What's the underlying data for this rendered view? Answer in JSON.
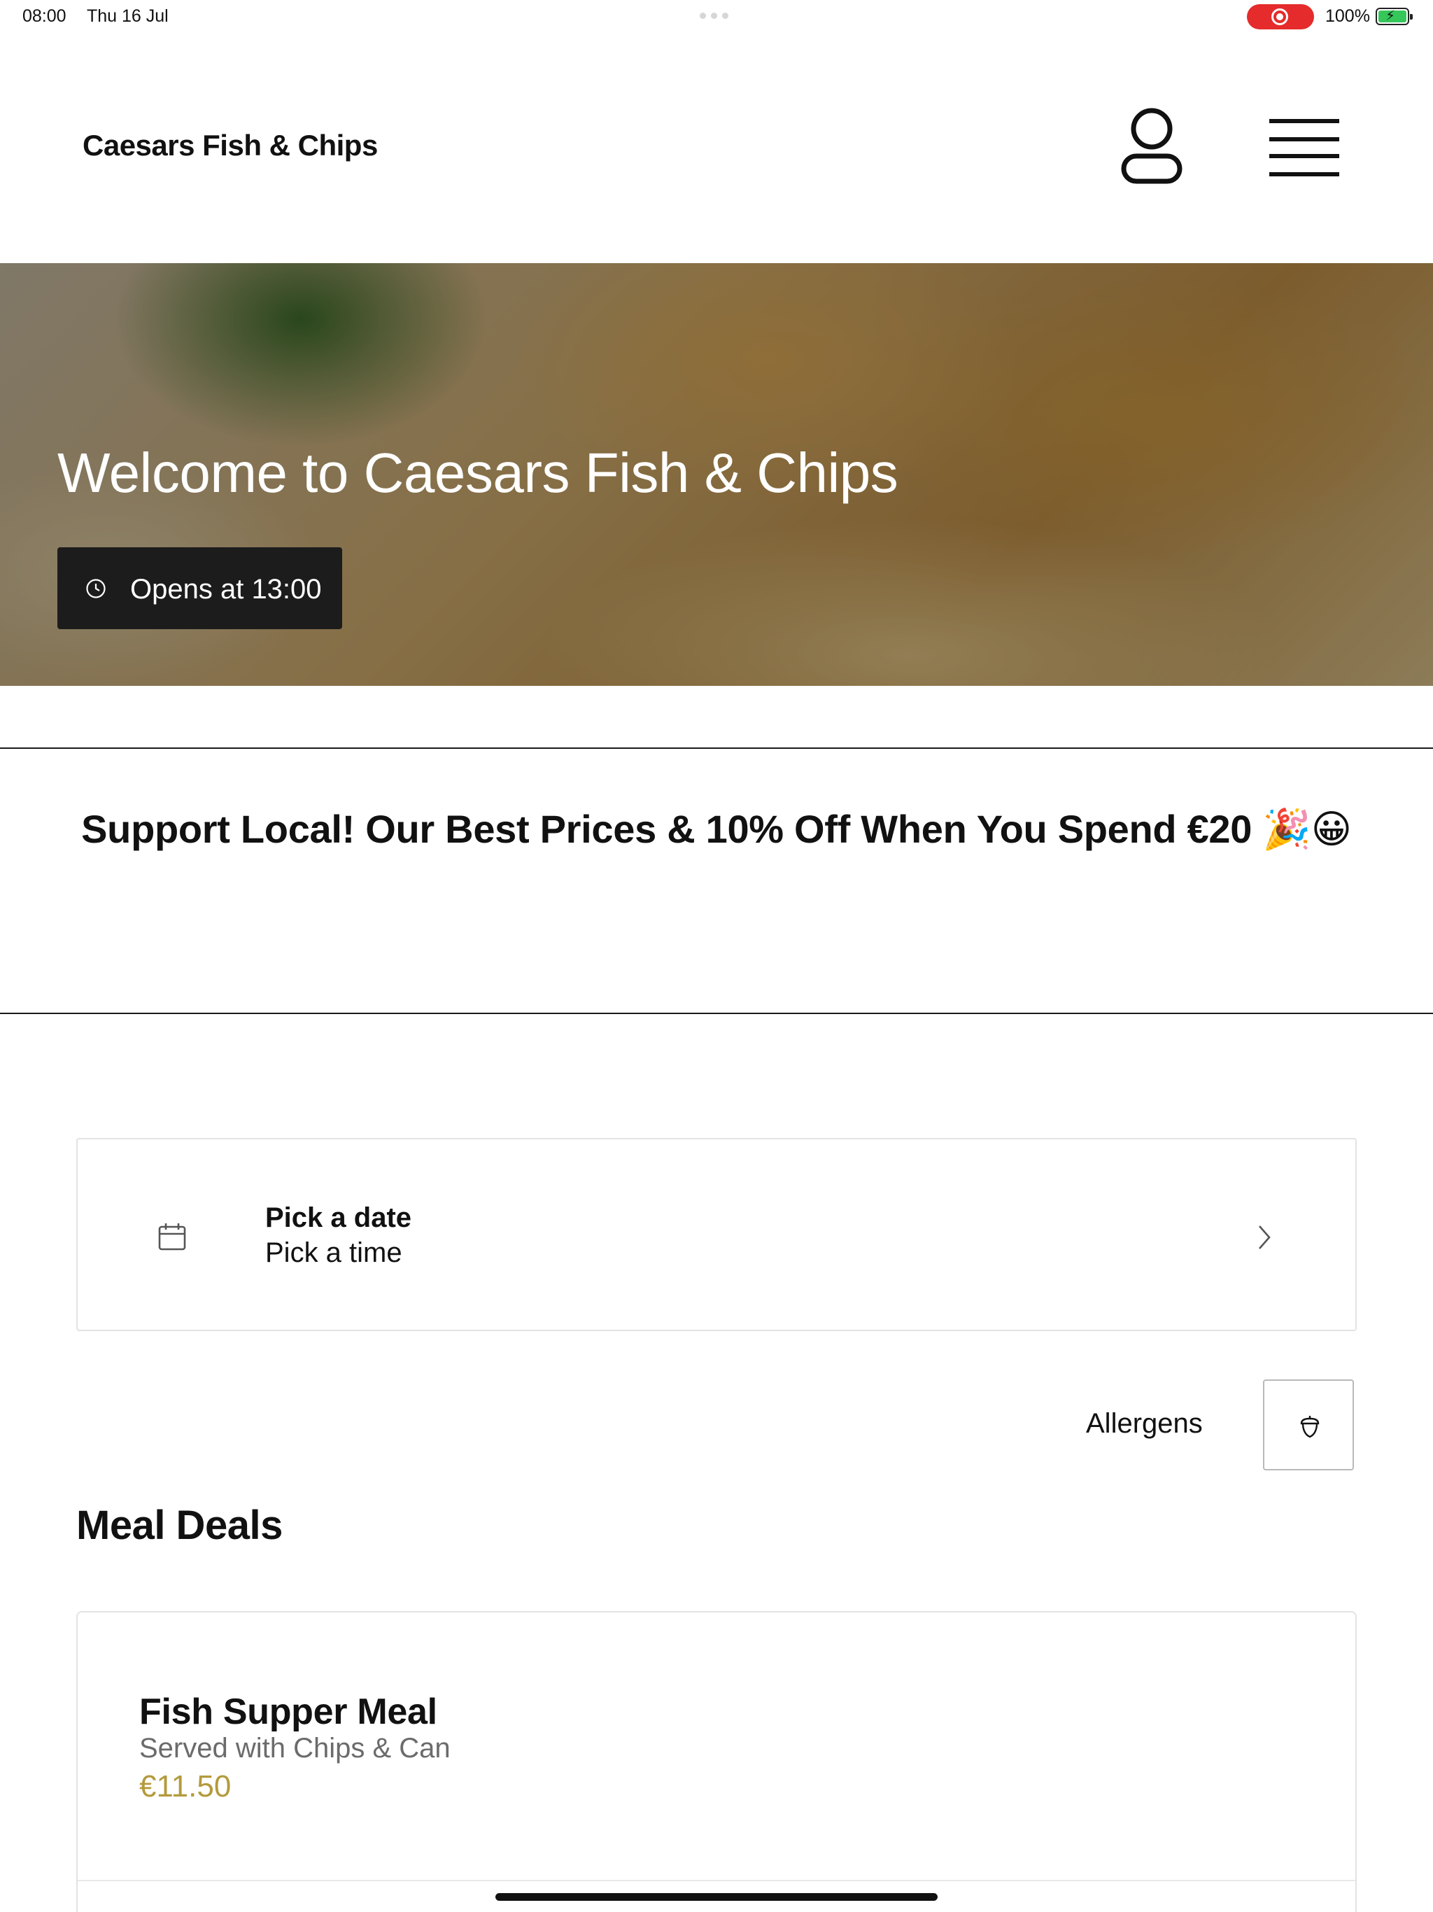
{
  "status_bar": {
    "time": "08:00",
    "date": "Thu 16 Jul",
    "battery_percent": "100%",
    "battery_level": 1.0,
    "screen_recording": true
  },
  "header": {
    "brand": "Caesars Fish & Chips",
    "account_icon": "user-icon",
    "menu_icon": "hamburger-menu-icon"
  },
  "hero": {
    "title": "Welcome to Caesars Fish & Chips",
    "hours_icon": "clock-icon",
    "hours_label": "Opens at 13:00"
  },
  "promo": {
    "text": "Support Local! Our Best Prices & 10% Off When You Spend €20 🎉😀"
  },
  "schedule": {
    "icon": "calendar-icon",
    "date_label": "Pick a date",
    "time_label": "Pick a time"
  },
  "allergens": {
    "label": "Allergens",
    "icon": "acorn-icon"
  },
  "sections": [
    {
      "title": "Meal Deals",
      "items": [
        {
          "name": "Fish Supper Meal",
          "description": "Served with Chips & Can",
          "price": "€11.50"
        }
      ]
    }
  ],
  "colors": {
    "price": "#b49a3c",
    "badge_bg": "#1c1c1c",
    "recording": "#e52b2b",
    "battery": "#35c759"
  }
}
